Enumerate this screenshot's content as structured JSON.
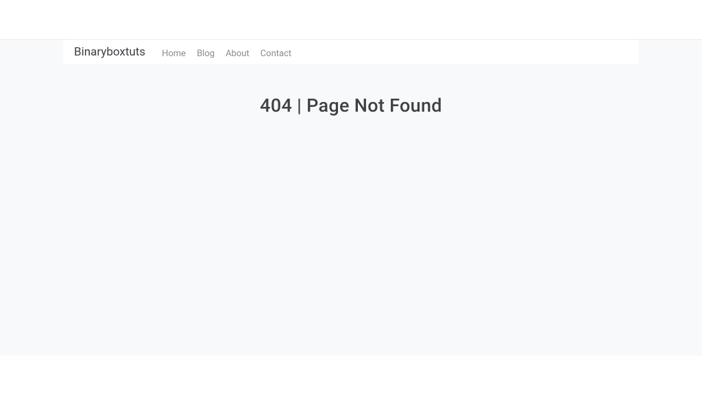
{
  "navbar": {
    "brand": "Binaryboxtuts",
    "links": [
      {
        "label": "Home"
      },
      {
        "label": "Blog"
      },
      {
        "label": "About"
      },
      {
        "label": "Contact"
      }
    ]
  },
  "main": {
    "error_message": "404 | Page Not Found"
  }
}
